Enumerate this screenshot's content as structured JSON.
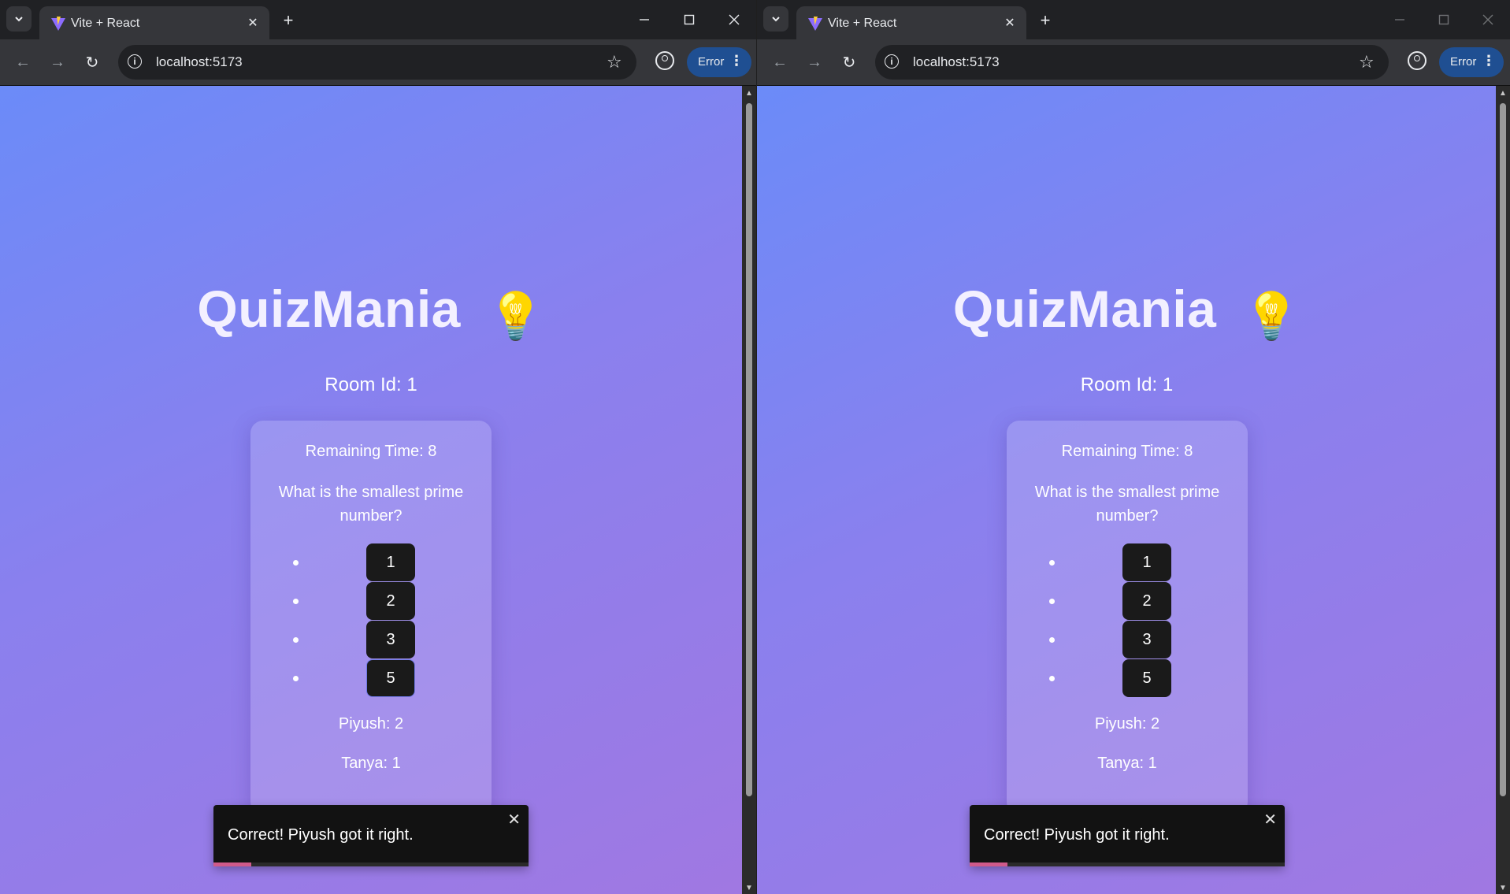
{
  "windows": [
    {
      "tab_title": "Vite + React",
      "url": "localhost:5173",
      "error_label": "Error",
      "heading": "QuizMania",
      "heading_emoji": "💡",
      "room": "Room Id: 1",
      "timer": "Remaining Time: 8",
      "question": "What is the smallest prime number?",
      "options": [
        "1",
        "2",
        "3",
        "5"
      ],
      "scores": [
        "Piyush: 2",
        "Tanya: 1"
      ],
      "toast": "Correct! Piyush got it right."
    },
    {
      "tab_title": "Vite + React",
      "url": "localhost:5173",
      "error_label": "Error",
      "heading": "QuizMania",
      "heading_emoji": "💡",
      "room": "Room Id: 1",
      "timer": "Remaining Time: 8",
      "question": "What is the smallest prime number?",
      "options": [
        "1",
        "2",
        "3",
        "5"
      ],
      "scores": [
        "Piyush: 2",
        "Tanya: 1"
      ],
      "toast": "Correct! Piyush got it right."
    }
  ],
  "icons": {
    "tab_list": "chevron-down-icon",
    "new_tab": "plus-icon",
    "minimize": "minimize-icon",
    "maximize": "maximize-icon",
    "close": "close-icon",
    "back": "arrow-left-icon",
    "forward": "arrow-right-icon",
    "reload": "reload-icon",
    "site_info": "info-icon",
    "bookmark": "star-icon",
    "profile": "profile-icon",
    "menu": "kebab-menu-icon"
  },
  "colors": {
    "gradient_start": "#6b8bf8",
    "gradient_end": "#a078e2",
    "option_button": "#1a1a1a",
    "toast_bg": "#121212",
    "error_chip": "#1f4f92"
  }
}
